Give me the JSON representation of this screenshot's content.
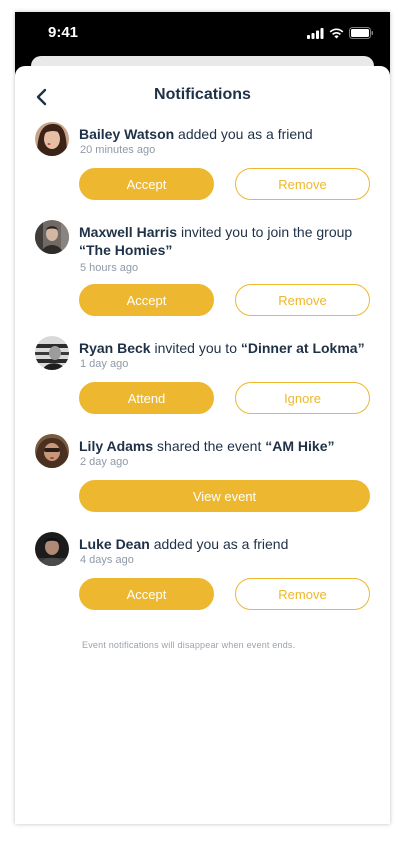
{
  "status": {
    "time": "9:41"
  },
  "header": {
    "title": "Notifications"
  },
  "notifications": [
    {
      "name": "Bailey Watson",
      "text": " added you as a friend",
      "highlight": "",
      "time": "20 minutes ago",
      "primary": "Accept",
      "secondary": "Remove"
    },
    {
      "name": "Maxwell Harris",
      "text": " invited you to join the group ",
      "highlight": "“The Homies”",
      "time": "5 hours ago",
      "primary": "Accept",
      "secondary": "Remove"
    },
    {
      "name": "Ryan Beck",
      "text": " invited you to ",
      "highlight": "“Dinner at Lokma”",
      "time": "1 day ago",
      "primary": "Attend",
      "secondary": "Ignore"
    },
    {
      "name": "Lily Adams",
      "text": " shared the event ",
      "highlight": "“AM Hike”",
      "time": "2 day ago",
      "primary": "View event",
      "secondary": ""
    },
    {
      "name": "Luke Dean",
      "text": " added you as a friend",
      "highlight": "",
      "time": "4 days ago",
      "primary": "Accept",
      "secondary": "Remove"
    }
  ],
  "footer": {
    "note": "Event notifications will disappear when event ends."
  },
  "colors": {
    "accent": "#edb72f",
    "text": "#1f3147",
    "muted": "#8f9aa7"
  },
  "icons": {
    "back": "chevron-left-icon",
    "signal": "signal-icon",
    "wifi": "wifi-icon",
    "battery": "battery-icon"
  }
}
